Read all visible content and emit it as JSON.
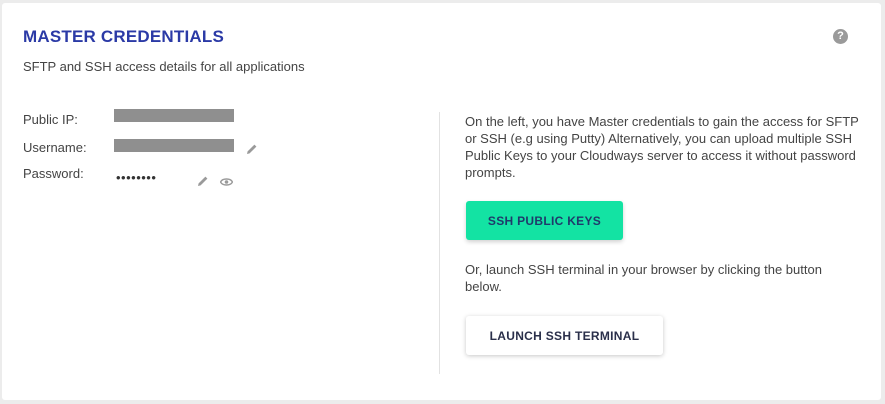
{
  "card": {
    "title": "MASTER CREDENTIALS",
    "subtitle": "SFTP and SSH access details for all applications",
    "help_icon": "?"
  },
  "credentials": {
    "public_ip_label": "Public IP:",
    "username_label": "Username:",
    "password_label": "Password:",
    "password_mask": "••••••••"
  },
  "info": {
    "text": "On the left, you have Master credentials to gain the access for SFTP or SSH (e.g using Putty) Alternatively, you can upload multiple SSH Public Keys to your Cloudways server to access it without password prompts.",
    "launch_text": "Or, launch SSH terminal in your browser by clicking the button below."
  },
  "buttons": {
    "ssh_keys": "SSH PUBLIC KEYS",
    "launch_terminal": "LAUNCH SSH TERMINAL"
  },
  "colors": {
    "title": "#2b3aa6",
    "primary_button": "#13e3a3"
  }
}
